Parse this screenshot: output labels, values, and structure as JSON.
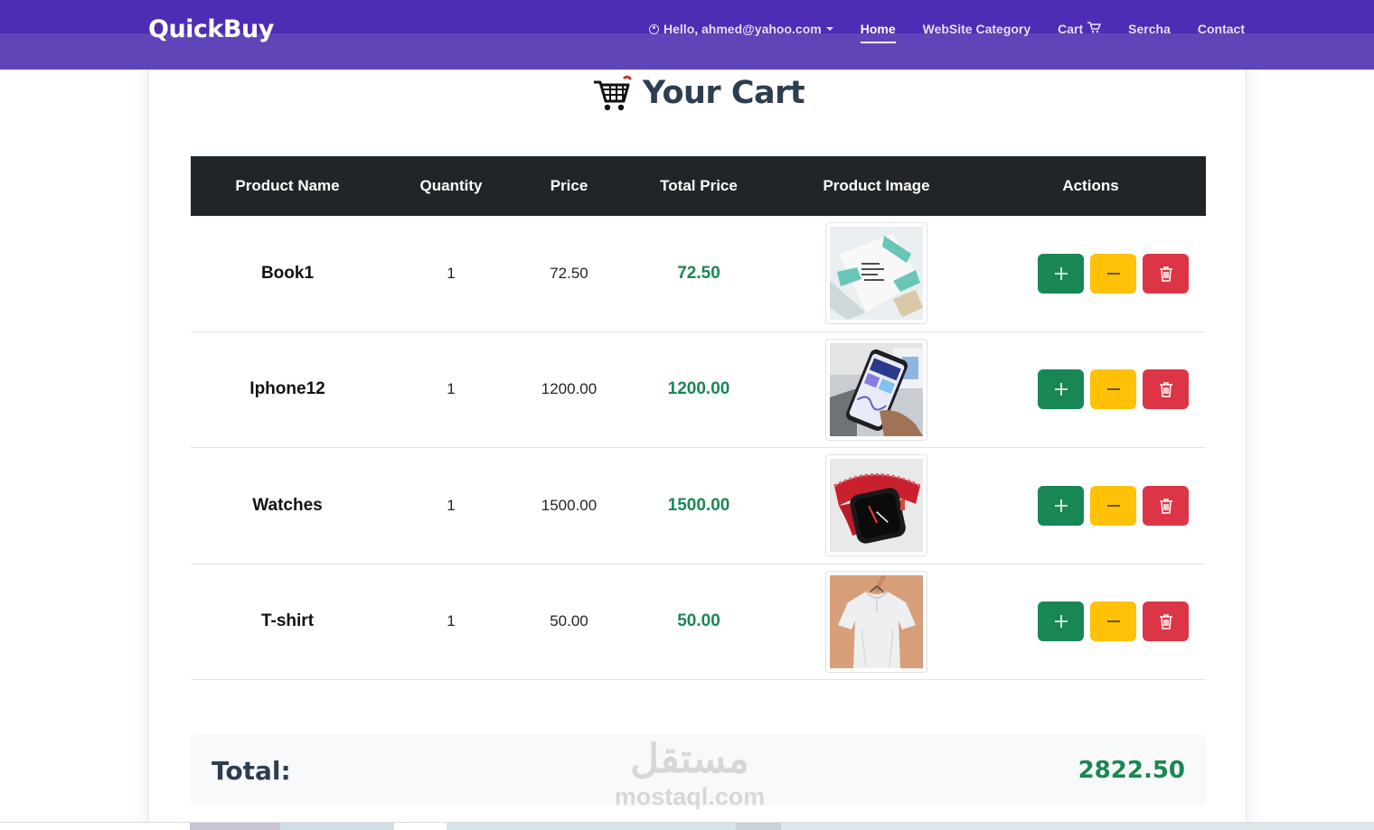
{
  "navbar": {
    "brand": "QuickBuy",
    "user_label": "Hello, ahmed@yahoo.com",
    "links": {
      "home": "Home",
      "category": "WebSite Category",
      "cart": "Cart",
      "search": "Sercha",
      "contact": "Contact"
    },
    "icons": {
      "user": "user-circle-icon",
      "cart": "cart-icon",
      "dropdown": "caret-down-icon"
    }
  },
  "page": {
    "title": "Your Cart",
    "title_icon": "shopping-cart-icon"
  },
  "table": {
    "headers": [
      "Product Name",
      "Quantity",
      "Price",
      "Total Price",
      "Product Image",
      "Actions"
    ],
    "rows": [
      {
        "name": "Book1",
        "quantity": "1",
        "price": "72.50",
        "total": "72.50",
        "image": "book-image"
      },
      {
        "name": "Iphone12",
        "quantity": "1",
        "price": "1200.00",
        "total": "1200.00",
        "image": "phone-image"
      },
      {
        "name": "Watches",
        "quantity": "1",
        "price": "1500.00",
        "total": "1500.00",
        "image": "watch-image"
      },
      {
        "name": "T-shirt",
        "quantity": "1",
        "price": "50.00",
        "total": "50.00",
        "image": "tshirt-image"
      }
    ],
    "action_icons": {
      "increase": "plus-icon",
      "decrease": "minus-icon",
      "remove": "trash-icon"
    }
  },
  "summary": {
    "label": "Total:",
    "value": "2822.50"
  },
  "watermark": {
    "arabic": "مستقل",
    "latin": "mostaql.com"
  },
  "colors": {
    "navbar": "#4d2db3",
    "header_bg": "#212529",
    "success": "#198754",
    "warning": "#ffc107",
    "danger": "#dc3545",
    "title": "#2c3e50"
  }
}
